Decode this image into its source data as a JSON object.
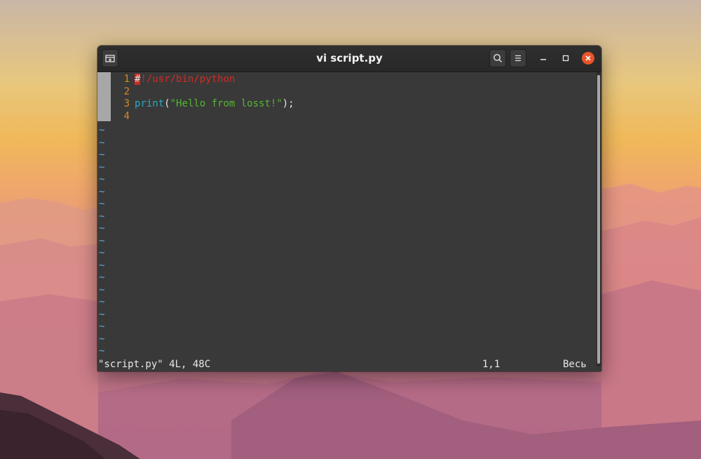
{
  "window": {
    "title": "vi script.py"
  },
  "editor": {
    "lines": [
      {
        "number": "1",
        "tokens": [
          {
            "text": "#",
            "cls": "shebang-at"
          },
          {
            "text": "!/usr/bin/python",
            "cls": "c-red"
          }
        ]
      },
      {
        "number": "2",
        "tokens": []
      },
      {
        "number": "3",
        "tokens": [
          {
            "text": "print",
            "cls": "c-cyan"
          },
          {
            "text": "(",
            "cls": "c-white"
          },
          {
            "text": "\"Hello from losst!\"",
            "cls": "c-green"
          },
          {
            "text": ");",
            "cls": "c-white"
          }
        ]
      },
      {
        "number": "4",
        "tokens": []
      }
    ],
    "empty_marker": "~",
    "empty_marker_count": 19
  },
  "statusline": {
    "file_info": "\"script.py\" 4L, 48C",
    "cursor_position": "1,1",
    "scroll_position": "Весь"
  },
  "colors": {
    "line_number": "#d28a25",
    "comment_red": "#d22b23",
    "keyword_cyan": "#2ca9b9",
    "string_green": "#57b533",
    "tilde_blue": "#6aa2d6",
    "close_button": "#e9542a"
  },
  "icons": {
    "new_tab": "new-tab-icon",
    "search": "search-icon",
    "menu": "hamburger-menu-icon",
    "minimize": "minimize-icon",
    "maximize": "maximize-icon",
    "close": "close-icon"
  }
}
